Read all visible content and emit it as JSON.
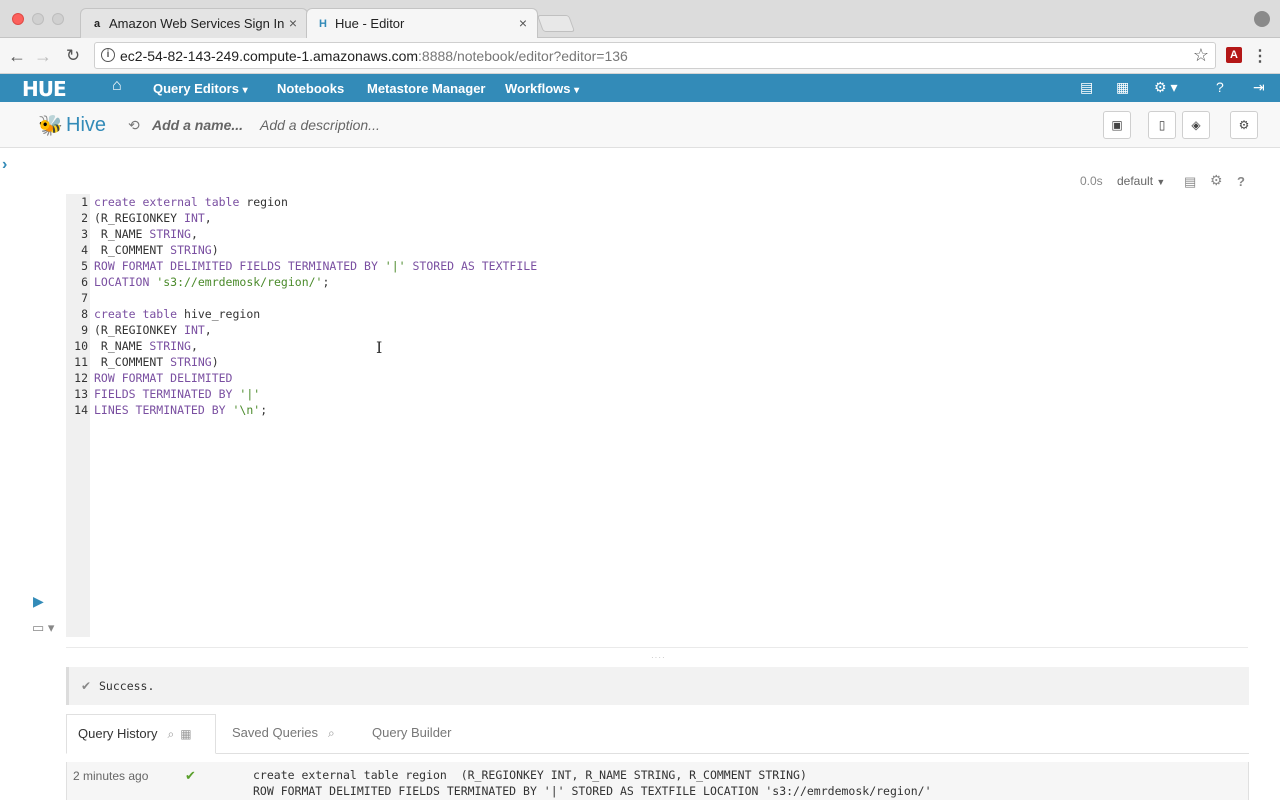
{
  "browser": {
    "tabs": [
      {
        "title": "Amazon Web Services Sign In",
        "favicon": "a"
      },
      {
        "title": "Hue - Editor",
        "favicon": "H"
      }
    ],
    "url_main": "ec2-54-82-143-249.compute-1.amazonaws.com",
    "url_rest": ":8888/notebook/editor?editor=136"
  },
  "hue_nav": {
    "logo": "HUE",
    "items": [
      "Query Editors",
      "Notebooks",
      "Metastore Manager",
      "Workflows"
    ]
  },
  "editor_header": {
    "app": "Hive",
    "name_placeholder": "Add a name...",
    "description_placeholder": "Add a description..."
  },
  "snippet": {
    "duration": "0.0s",
    "database": "default"
  },
  "code_lines": [
    [
      [
        "kw",
        "create external table"
      ],
      [
        "tx",
        " region"
      ]
    ],
    [
      [
        "tx",
        "(R_REGIONKEY "
      ],
      [
        "ty",
        "INT"
      ],
      [
        "tx",
        ","
      ]
    ],
    [
      [
        "tx",
        " R_NAME "
      ],
      [
        "ty",
        "STRING"
      ],
      [
        "tx",
        ","
      ]
    ],
    [
      [
        "tx",
        " R_COMMENT "
      ],
      [
        "ty",
        "STRING"
      ],
      [
        "tx",
        ")"
      ]
    ],
    [
      [
        "kw",
        "ROW FORMAT DELIMITED FIELDS TERMINATED BY "
      ],
      [
        "st",
        "'|'"
      ],
      [
        "kw",
        " STORED AS TEXTFILE"
      ]
    ],
    [
      [
        "kw",
        "LOCATION "
      ],
      [
        "st",
        "'s3://emrdemosk/region/'"
      ],
      [
        "tx",
        ";"
      ]
    ],
    [
      [
        "tx",
        ""
      ]
    ],
    [
      [
        "kw",
        "create table"
      ],
      [
        "tx",
        " hive_region"
      ]
    ],
    [
      [
        "tx",
        "(R_REGIONKEY "
      ],
      [
        "ty",
        "INT"
      ],
      [
        "tx",
        ","
      ]
    ],
    [
      [
        "tx",
        " R_NAME "
      ],
      [
        "ty",
        "STRING"
      ],
      [
        "tx",
        ","
      ]
    ],
    [
      [
        "tx",
        " R_COMMENT "
      ],
      [
        "ty",
        "STRING"
      ],
      [
        "tx",
        ")"
      ]
    ],
    [
      [
        "kw",
        "ROW FORMAT DELIMITED"
      ]
    ],
    [
      [
        "kw",
        "FIELDS TERMINATED BY "
      ],
      [
        "st",
        "'|'"
      ]
    ],
    [
      [
        "kw",
        "LINES TERMINATED BY "
      ],
      [
        "st",
        "'\\n'"
      ],
      [
        "tx",
        ";"
      ]
    ]
  ],
  "status": {
    "message": "Success."
  },
  "result_tabs": [
    "Query History",
    "Saved Queries",
    "Query Builder"
  ],
  "history": [
    {
      "time": "2 minutes ago",
      "line1": "create external table region  (R_REGIONKEY INT, R_NAME STRING, R_COMMENT STRING)",
      "line2": "ROW FORMAT DELIMITED FIELDS TERMINATED BY '|' STORED AS TEXTFILE LOCATION 's3://emrdemosk/region/'"
    }
  ]
}
